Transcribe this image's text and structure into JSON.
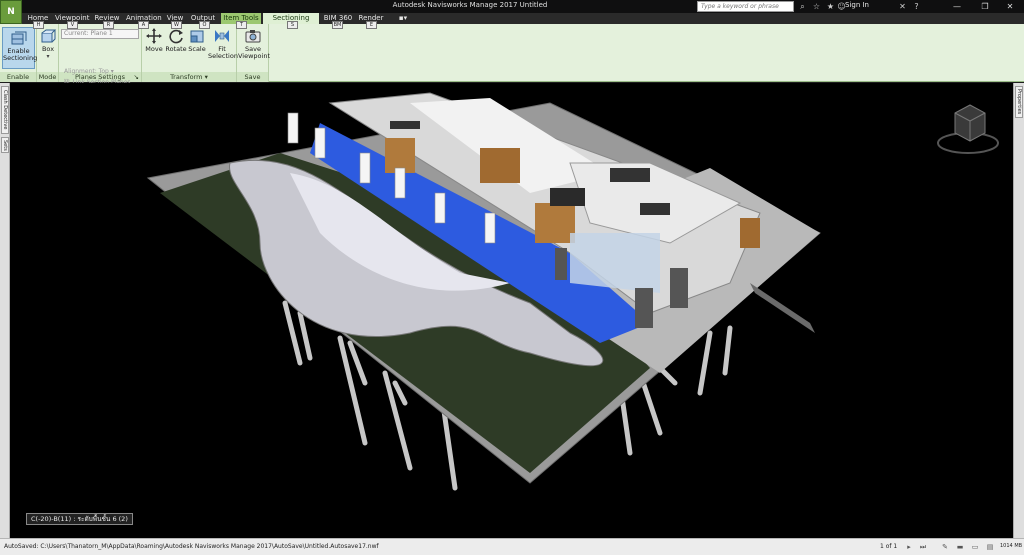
{
  "app": {
    "title": "Autodesk Navisworks Manage 2017    Untitled",
    "app_button": "N"
  },
  "titlebar": {
    "search_placeholder": "Type a keyword or phrase",
    "sign_in": "Sign In"
  },
  "tabs": [
    {
      "label": "Home",
      "key": "H"
    },
    {
      "label": "Viewpoint",
      "key": "V"
    },
    {
      "label": "Review",
      "key": "R"
    },
    {
      "label": "Animation",
      "key": "A"
    },
    {
      "label": "View",
      "key": "W"
    },
    {
      "label": "Output",
      "key": "O"
    },
    {
      "label": "Item Tools",
      "key": "T"
    },
    {
      "label": "Sectioning Tools",
      "key": "S"
    },
    {
      "label": "BIM 360",
      "key": "BM"
    },
    {
      "label": "Render",
      "key": "E"
    }
  ],
  "ribbon": {
    "enable": {
      "button": "Enable\nSectioning",
      "panel": "Enable"
    },
    "mode": {
      "button": "Box",
      "panel": "Mode"
    },
    "planes": {
      "current": "Current: Plane 1",
      "alignment": "Alignment: Top",
      "link": "Link Section Planes",
      "panel": "Planes Settings"
    },
    "transform": {
      "move": "Move",
      "rotate": "Rotate",
      "scale": "Scale",
      "fit": "Fit\nSelection",
      "panel": "Transform"
    },
    "save": {
      "button": "Save\nViewpoint",
      "panel": "Save"
    }
  },
  "side_tabs": {
    "left": [
      "Clash Detective",
      "Sets"
    ],
    "right": [
      "Properties"
    ]
  },
  "viewport": {
    "selection_label": "C(-20)-B(11) : ระดับพื้นชั้น 6 (2)"
  },
  "statusbar": {
    "autosave": "AutoSaved: C:\\Users\\Thanatorn_M\\AppData\\Roaming\\Autodesk Navisworks Manage 2017\\AutoSave\\Untitled.Autosave17.nwf",
    "page": "1 of 1",
    "memory": "1014 MB"
  },
  "colors": {
    "ribbon_bg": "#e4f1dc",
    "context_tab": "#9cc870",
    "viewport_bg": "#000000",
    "floor_blue": "#2d5be0"
  }
}
